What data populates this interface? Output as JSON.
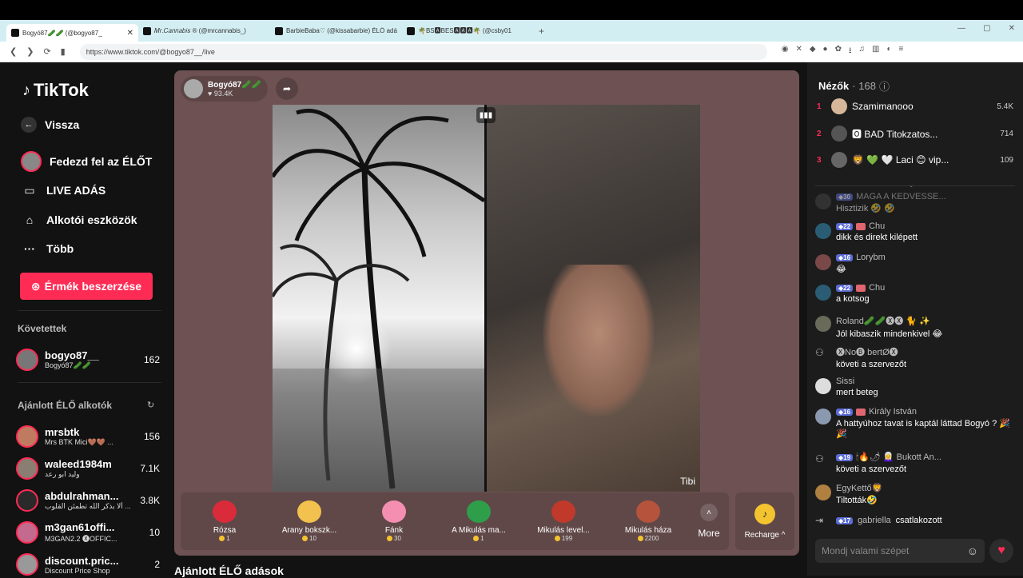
{
  "browser": {
    "tabs": [
      {
        "label": "Bogyó87🥒🥒 (@bogyo87_",
        "active": true
      },
      {
        "label": "𝑀𝑟.𝐶𝑎𝑛𝑛𝑎𝑏𝑖𝑠 ® (@mrcannabis_)",
        "active": false
      },
      {
        "label": "BarbieBaba♡ (@kissabarbie) ÉLŐ adá",
        "active": false
      },
      {
        "label": "🌴BS🅰BES🅰🅰🅰🌴 (@csby01",
        "active": false
      }
    ],
    "url": "https://www.tiktok.com/@bogyo87__/live"
  },
  "sidebar": {
    "logo": "TikTok",
    "back": "Vissza",
    "nav": [
      {
        "label": "Fedezd fel az ÉLŐT",
        "icon": "avatar-icon"
      },
      {
        "label": "LIVE ADÁS",
        "icon": "video-camera-icon"
      },
      {
        "label": "Alkotói eszközök",
        "icon": "creator-tools-icon"
      },
      {
        "label": "Több",
        "icon": "more-dots-icon"
      }
    ],
    "coin_button": "Érmék beszerzése",
    "following_title": "Követettek",
    "following": [
      {
        "name": "bogyo87__",
        "sub": "Bogyó87🥒🥒",
        "count": "162"
      }
    ],
    "recommended_title": "Ajánlott ÉLŐ alkotók",
    "recommended": [
      {
        "name": "mrsbtk",
        "sub": "Mrs BTK Mici🤎🤎 ...",
        "count": "156"
      },
      {
        "name": "waleed1984m",
        "sub": "وليد ابو رعد",
        "count": "7.1K"
      },
      {
        "name": "abdulrahman...",
        "sub": "ألا بذكر الله تطمئن القلوب ...",
        "count": "3.8K"
      },
      {
        "name": "m3gan61offi...",
        "sub": "M3GAN2.2 🅧OFFIC...",
        "count": "10"
      },
      {
        "name": "discount.pric...",
        "sub": "Discount Price Shop",
        "count": "2"
      }
    ]
  },
  "stream": {
    "host_name": "Bogyó87🥒🥒",
    "host_likes": "♥ 93.4K",
    "guest_label": "Tibi",
    "gifts": [
      {
        "name": "Rózsa",
        "price": "1",
        "color": "#d92b3a"
      },
      {
        "name": "Arany bokszk...",
        "price": "10",
        "color": "#f2c14e"
      },
      {
        "name": "Fánk",
        "price": "30",
        "color": "#f48fb1"
      },
      {
        "name": "A Mikulás ma...",
        "price": "1",
        "color": "#2e9e4a"
      },
      {
        "name": "Mikulás level...",
        "price": "199",
        "color": "#c0392b"
      },
      {
        "name": "Mikulás háza",
        "price": "2200",
        "color": "#b5533c"
      }
    ],
    "more_label": "More",
    "recharge_label": "Recharge ^",
    "recommended_section": "Ajánlott ÉLŐ adások"
  },
  "viewers": {
    "title": "Nézők",
    "count": "· 168",
    "top": [
      {
        "rank": "1",
        "name": "Szamimanooo",
        "score": "5.4K"
      },
      {
        "rank": "2",
        "name": "🅾 BAD Titokzatos...",
        "score": "714"
      },
      {
        "rank": "3",
        "name": "🦁 💚 🤍 Laci 😊 vip...",
        "score": "109"
      }
    ]
  },
  "chat": [
    {
      "level": "30",
      "user": "MAGA A KEDVESSE...",
      "text": "Hisztizik 🤣 🤣",
      "fan": false
    },
    {
      "level": "22",
      "user": "Chu",
      "text": "dikk és direkt kilépett",
      "fan": true
    },
    {
      "level": "16",
      "user": "Lorybm",
      "text": "😂",
      "fan": false
    },
    {
      "level": "22",
      "user": "Chu",
      "text": "a kotsog",
      "fan": true
    },
    {
      "level": "",
      "user": "Roland🥒🥒🅧🅧 🐈 ✨",
      "text": "Jól kibaszik mindenkivel 😂",
      "fan": false
    },
    {
      "level": "",
      "user": "🅧No🅑 bertØ🅧",
      "text": "követi a szervezőt",
      "fan": false
    },
    {
      "level": "",
      "user": "Sissi",
      "text": "mert beteg",
      "fan": false
    },
    {
      "level": "16",
      "user": "Király István",
      "text": "A hattyúhoz tavat is kaptál láttad Bogyó ? 🎉 🎉",
      "fan": true
    },
    {
      "level": "19",
      "user": "🕯🔥🌶 👩‍🦳 Bukott An...",
      "text": "követi a szervezőt",
      "fan": false
    },
    {
      "level": "",
      "user": "EgyKettő🦁",
      "text": "Tiltották🤣",
      "fan": false
    }
  ],
  "joined": {
    "level": "17",
    "user": "gabriella",
    "text": "csatlakozott"
  },
  "input_placeholder": "Mondj valami szépet"
}
